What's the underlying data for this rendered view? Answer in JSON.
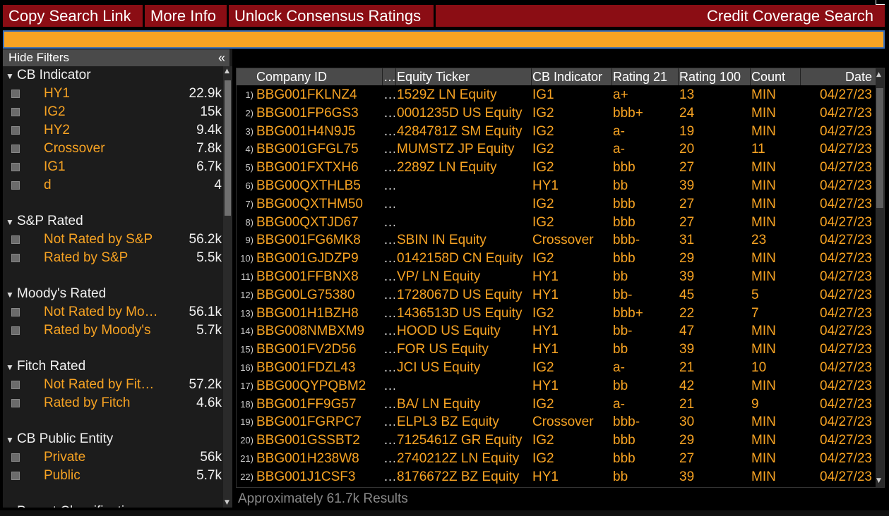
{
  "toolbar": {
    "copy_link": "Copy Search Link",
    "more_info": "More Info",
    "unlock": "Unlock Consensus Ratings",
    "title": "Credit Coverage Search"
  },
  "search": {
    "value": ""
  },
  "filters": {
    "hide_label": "Hide Filters",
    "collapse_icon": "«",
    "sections": [
      {
        "title": "CB Indicator",
        "items": [
          {
            "label": "HY1",
            "count": "22.9k"
          },
          {
            "label": "IG2",
            "count": "15k"
          },
          {
            "label": "HY2",
            "count": "9.4k"
          },
          {
            "label": "Crossover",
            "count": "7.8k"
          },
          {
            "label": "IG1",
            "count": "6.7k"
          },
          {
            "label": "d",
            "count": "4"
          }
        ]
      },
      {
        "title": "S&P Rated",
        "items": [
          {
            "label": "Not Rated by S&P",
            "count": "56.2k"
          },
          {
            "label": "Rated by S&P",
            "count": "5.5k"
          }
        ]
      },
      {
        "title": "Moody's Rated",
        "items": [
          {
            "label": "Not Rated by Mo…",
            "count": "56.1k"
          },
          {
            "label": "Rated by Moody's",
            "count": "5.7k"
          }
        ]
      },
      {
        "title": "Fitch Rated",
        "items": [
          {
            "label": "Not Rated by Fit…",
            "count": "57.2k"
          },
          {
            "label": "Rated by Fitch",
            "count": "4.6k"
          }
        ]
      },
      {
        "title": "CB Public Entity",
        "items": [
          {
            "label": "Private",
            "count": "56k"
          },
          {
            "label": "Public",
            "count": "5.7k"
          }
        ]
      },
      {
        "title": "Parent Classification",
        "items": []
      }
    ]
  },
  "table": {
    "columns": [
      "Company ID",
      "…",
      "Equity Ticker",
      "CB Indicator",
      "Rating 21",
      "Rating 100",
      "Count",
      "Date"
    ],
    "rows": [
      [
        "1)",
        "BBG001FKLNZ4",
        "…",
        "1529Z LN Equity",
        "IG1",
        "a+",
        "13",
        "MIN",
        "04/27/23"
      ],
      [
        "2)",
        "BBG001FP6GS3",
        "…",
        "0001235D US Equity",
        "IG2",
        "bbb+",
        "24",
        "MIN",
        "04/27/23"
      ],
      [
        "3)",
        "BBG001H4N9J5",
        "…",
        "4284781Z SM Equity",
        "IG2",
        "a-",
        "19",
        "MIN",
        "04/27/23"
      ],
      [
        "4)",
        "BBG001GFGL75",
        "…",
        "MUMSTZ JP Equity",
        "IG2",
        "a-",
        "20",
        "11",
        "04/27/23"
      ],
      [
        "5)",
        "BBG001FXTXH6",
        "…",
        "2289Z LN Equity",
        "IG2",
        "bbb",
        "27",
        "MIN",
        "04/27/23"
      ],
      [
        "6)",
        "BBG00QXTHLB5",
        "…",
        "",
        "HY1",
        "bb",
        "39",
        "MIN",
        "04/27/23"
      ],
      [
        "7)",
        "BBG00QXTHM50",
        "…",
        "",
        "IG2",
        "bbb",
        "27",
        "MIN",
        "04/27/23"
      ],
      [
        "8)",
        "BBG00QXTJD67",
        "…",
        "",
        "IG2",
        "bbb",
        "27",
        "MIN",
        "04/27/23"
      ],
      [
        "9)",
        "BBG001FG6MK8",
        "…",
        "SBIN IN Equity",
        "Crossover",
        "bbb-",
        "31",
        "23",
        "04/27/23"
      ],
      [
        "10)",
        "BBG001GJDZP9",
        "…",
        "0142158D CN Equity",
        "IG2",
        "bbb",
        "29",
        "MIN",
        "04/27/23"
      ],
      [
        "11)",
        "BBG001FFBNX8",
        "…",
        "VP/ LN Equity",
        "HY1",
        "bb",
        "39",
        "MIN",
        "04/27/23"
      ],
      [
        "12)",
        "BBG00LG75380",
        "…",
        "1728067D US Equity",
        "HY1",
        "bb-",
        "45",
        "5",
        "04/27/23"
      ],
      [
        "13)",
        "BBG001H1BZH8",
        "…",
        "1436513D US Equity",
        "IG2",
        "bbb+",
        "22",
        "7",
        "04/27/23"
      ],
      [
        "14)",
        "BBG008NMBXM9",
        "…",
        "HOOD US Equity",
        "HY1",
        "bb-",
        "47",
        "MIN",
        "04/27/23"
      ],
      [
        "15)",
        "BBG001FV2D56",
        "…",
        "FOR US Equity",
        "HY1",
        "bb",
        "39",
        "MIN",
        "04/27/23"
      ],
      [
        "16)",
        "BBG001FDZL43",
        "…",
        "JCI US Equity",
        "IG2",
        "a-",
        "21",
        "10",
        "04/27/23"
      ],
      [
        "17)",
        "BBG00QYPQBM2",
        "…",
        "",
        "HY1",
        "bb",
        "42",
        "MIN",
        "04/27/23"
      ],
      [
        "18)",
        "BBG001FF9G57",
        "…",
        "BA/ LN Equity",
        "IG2",
        "a-",
        "21",
        "9",
        "04/27/23"
      ],
      [
        "19)",
        "BBG001FGRPC7",
        "…",
        "ELPL3 BZ Equity",
        "Crossover",
        "bbb-",
        "30",
        "MIN",
        "04/27/23"
      ],
      [
        "20)",
        "BBG001GSSBT2",
        "…",
        "7125461Z GR Equity",
        "IG2",
        "bbb",
        "29",
        "MIN",
        "04/27/23"
      ],
      [
        "21)",
        "BBG001H238W8",
        "…",
        "2740212Z LN Equity",
        "IG2",
        "bbb",
        "27",
        "MIN",
        "04/27/23"
      ],
      [
        "22)",
        "BBG001J1CSF3",
        "…",
        "8176672Z BZ Equity",
        "HY1",
        "bb",
        "39",
        "MIN",
        "04/27/23"
      ]
    ]
  },
  "status": "Approximately 61.7k Results",
  "colors": {
    "accent": "#f7a323",
    "toolbar": "#8b0d14",
    "header": "#4a4a4a"
  }
}
